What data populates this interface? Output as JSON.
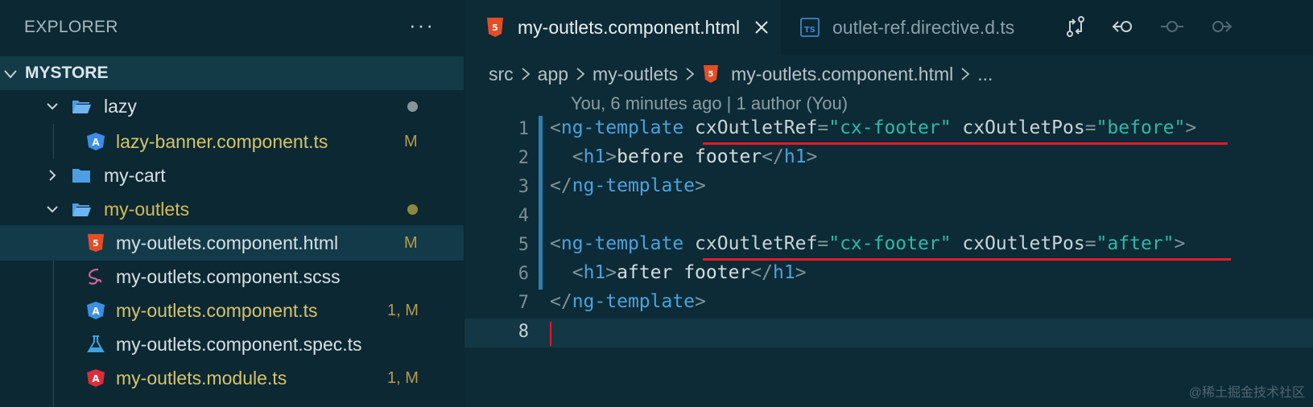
{
  "sidebar": {
    "title": "EXPLORER",
    "more_label": "···",
    "project": "MYSTORE",
    "items": [
      {
        "label": "lazy",
        "type": "folder-open",
        "status": "dot-gray"
      },
      {
        "label": "lazy-banner.component.ts",
        "type": "angular-ts",
        "badge": "M"
      },
      {
        "label": "my-cart",
        "type": "folder-closed"
      },
      {
        "label": "my-outlets",
        "type": "folder-open",
        "status": "dot-olive"
      },
      {
        "label": "my-outlets.component.html",
        "type": "html",
        "badge": "M",
        "selected": true
      },
      {
        "label": "my-outlets.component.scss",
        "type": "sass"
      },
      {
        "label": "my-outlets.component.ts",
        "type": "angular-ts",
        "badge": "1, M"
      },
      {
        "label": "my-outlets.component.spec.ts",
        "type": "test"
      },
      {
        "label": "my-outlets.module.ts",
        "type": "angular-module",
        "badge": "1, M"
      }
    ]
  },
  "tabs": [
    {
      "label": "my-outlets.component.html",
      "icon": "html5-icon",
      "active": true
    },
    {
      "label": "outlet-ref.directive.d.ts",
      "icon": "typescript-icon",
      "active": false
    }
  ],
  "editor_actions": [
    "compare-changes-icon",
    "go-back-icon",
    "commit-icon",
    "go-forward-icon"
  ],
  "breadcrumb": {
    "parts": [
      "src",
      "app",
      "my-outlets",
      "my-outlets.component.html",
      "..."
    ]
  },
  "blame": "You, 6 minutes ago | 1 author (You)",
  "code_lines": [
    {
      "n": "1",
      "text": "<ng-template cxOutletRef=\"cx-footer\" cxOutletPos=\"before\">"
    },
    {
      "n": "2",
      "text": "  <h1>before footer</h1>"
    },
    {
      "n": "3",
      "text": "</ng-template>"
    },
    {
      "n": "4",
      "text": ""
    },
    {
      "n": "5",
      "text": "<ng-template cxOutletRef=\"cx-footer\" cxOutletPos=\"after\">"
    },
    {
      "n": "6",
      "text": "  <h1>after footer</h1>"
    },
    {
      "n": "7",
      "text": "</ng-template>"
    },
    {
      "n": "8",
      "text": ""
    }
  ],
  "watermark": "@稀土掘金技术社区",
  "colors": {
    "background": "#0b2833",
    "tag": "#4aa3df",
    "string": "#2fb8a8",
    "annotation_red": "#e4192a",
    "modified_badge": "#b89b4b"
  }
}
